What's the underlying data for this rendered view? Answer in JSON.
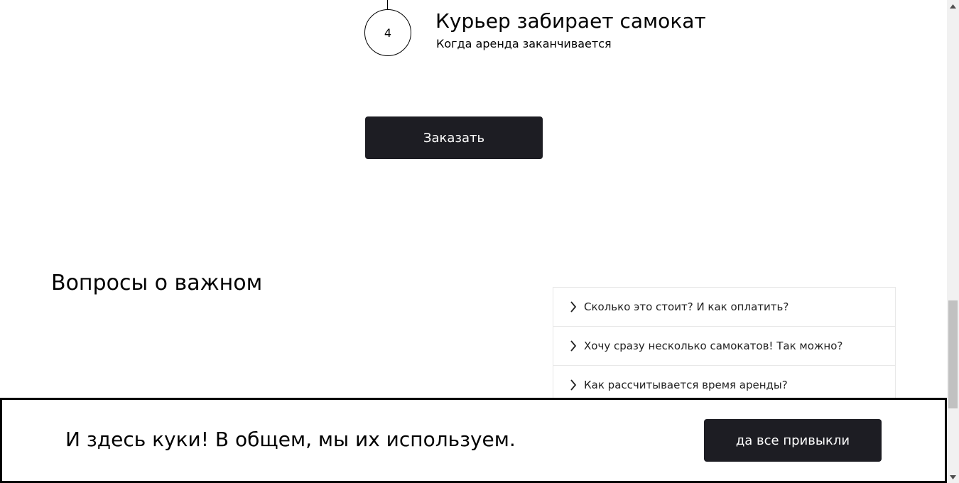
{
  "step": {
    "number": "4",
    "title": "Курьер забирает самокат",
    "subtitle": "Когда аренда заканчивается"
  },
  "order_button": {
    "label": "Заказать"
  },
  "faq": {
    "heading": "Вопросы о важном",
    "items": [
      {
        "question": "Сколько это стоит? И как оплатить?"
      },
      {
        "question": "Хочу сразу несколько самокатов! Так можно?"
      },
      {
        "question": "Как рассчитывается время аренды?"
      }
    ]
  },
  "cookie_banner": {
    "text": "И здесь куки! В общем, мы их используем.",
    "button_label": "да все привыкли"
  },
  "icons": {
    "faq_chevron": "chevron-right-icon",
    "scroll_up": "scroll-up-arrow-icon",
    "scroll_down": "scroll-down-arrow-icon"
  },
  "colors": {
    "button_bg": "#1d1d23",
    "button_text": "#ffffff",
    "border": "#e8e8e8"
  }
}
